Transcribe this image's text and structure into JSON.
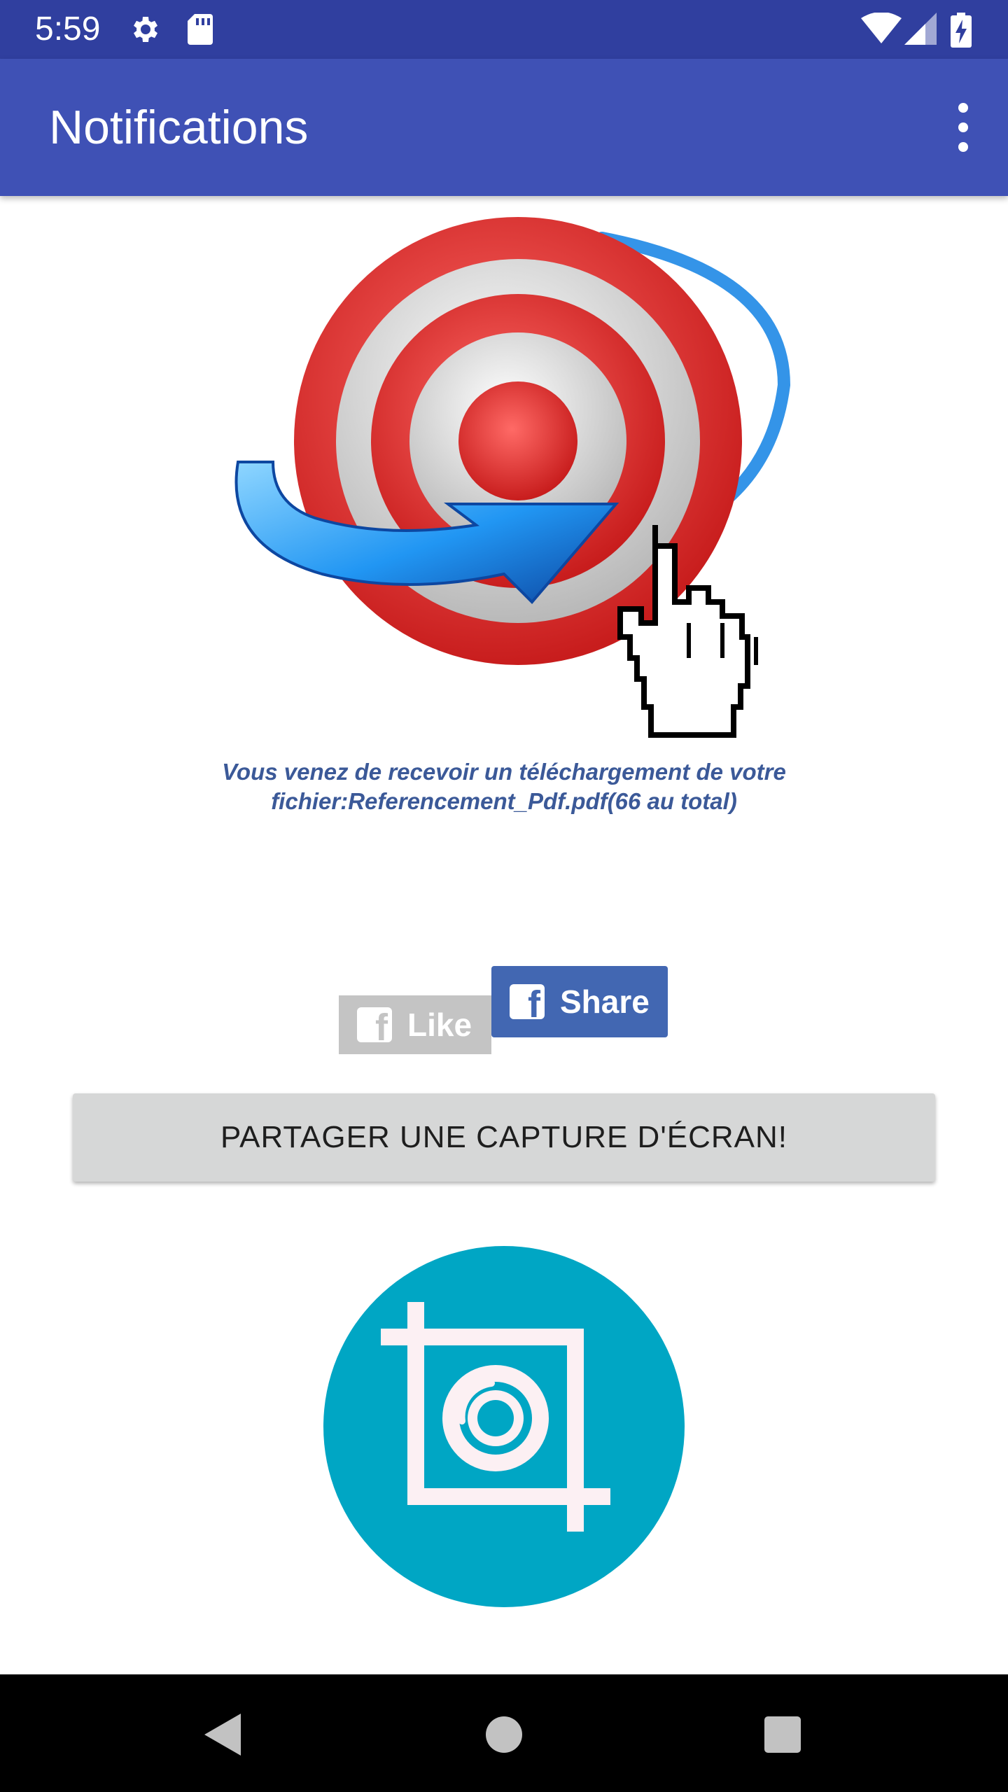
{
  "status_bar": {
    "time": "5:59",
    "icons": [
      "gear-icon",
      "sd-card-icon",
      "wifi-icon",
      "cellular-signal-icon",
      "battery-charging-icon"
    ],
    "background": "#303f9f"
  },
  "app_bar": {
    "title": "Notifications",
    "overflow_icon": "more-vert-icon",
    "background": "#3f51b5"
  },
  "hero_image": {
    "icon": "target-arrow-cursor-icon"
  },
  "message": {
    "text": "Vous venez de recevoir un téléchargement de votre fichier:Referencement_Pdf.pdf(66 au total)",
    "color": "#3b5998"
  },
  "facebook": {
    "like_label": "Like",
    "share_label": "Share",
    "like_color": "#c4c4c4",
    "share_color": "#4267b2"
  },
  "capture_button": {
    "label": "PARTAGER UNE CAPTURE D'ÉCRAN!"
  },
  "screenshot_icon": {
    "icon": "screenshot-crop-camera-icon",
    "color": "#00a6c4"
  },
  "nav_bar": {
    "icons": [
      "back-icon",
      "home-icon",
      "recents-icon"
    ]
  }
}
